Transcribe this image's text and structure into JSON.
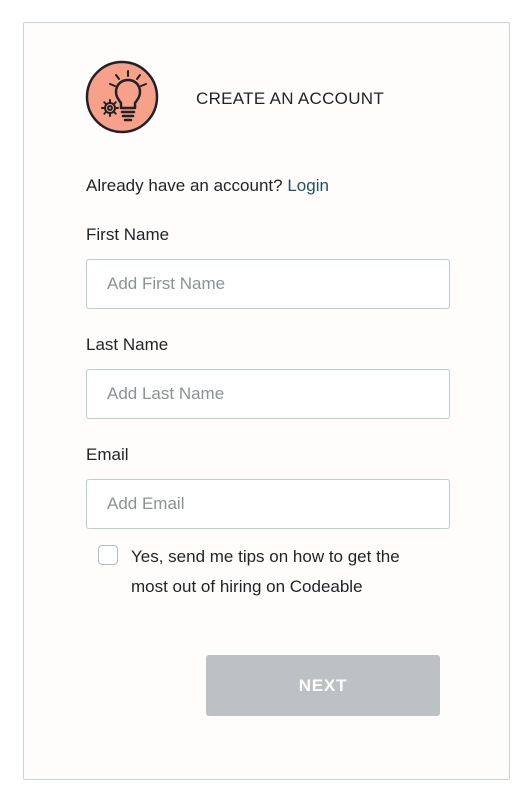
{
  "header": {
    "title": "CREATE AN ACCOUNT",
    "logo_icon": "lightbulb-gear-icon"
  },
  "login_prompt": {
    "text": "Already have an account?",
    "link_label": "Login"
  },
  "form": {
    "first_name": {
      "label": "First Name",
      "placeholder": "Add First Name",
      "value": ""
    },
    "last_name": {
      "label": "Last Name",
      "placeholder": "Add Last Name",
      "value": ""
    },
    "email": {
      "label": "Email",
      "placeholder": "Add Email",
      "value": ""
    },
    "tips_checkbox": {
      "label": "Yes, send me tips on how to get the most out of hiring on Codeable",
      "checked": false
    },
    "next_label": "NEXT"
  },
  "colors": {
    "logo_bg": "#f7a08a",
    "link": "#24515a",
    "button_disabled": "#bcc1c3",
    "border": "#c7d6d4"
  }
}
